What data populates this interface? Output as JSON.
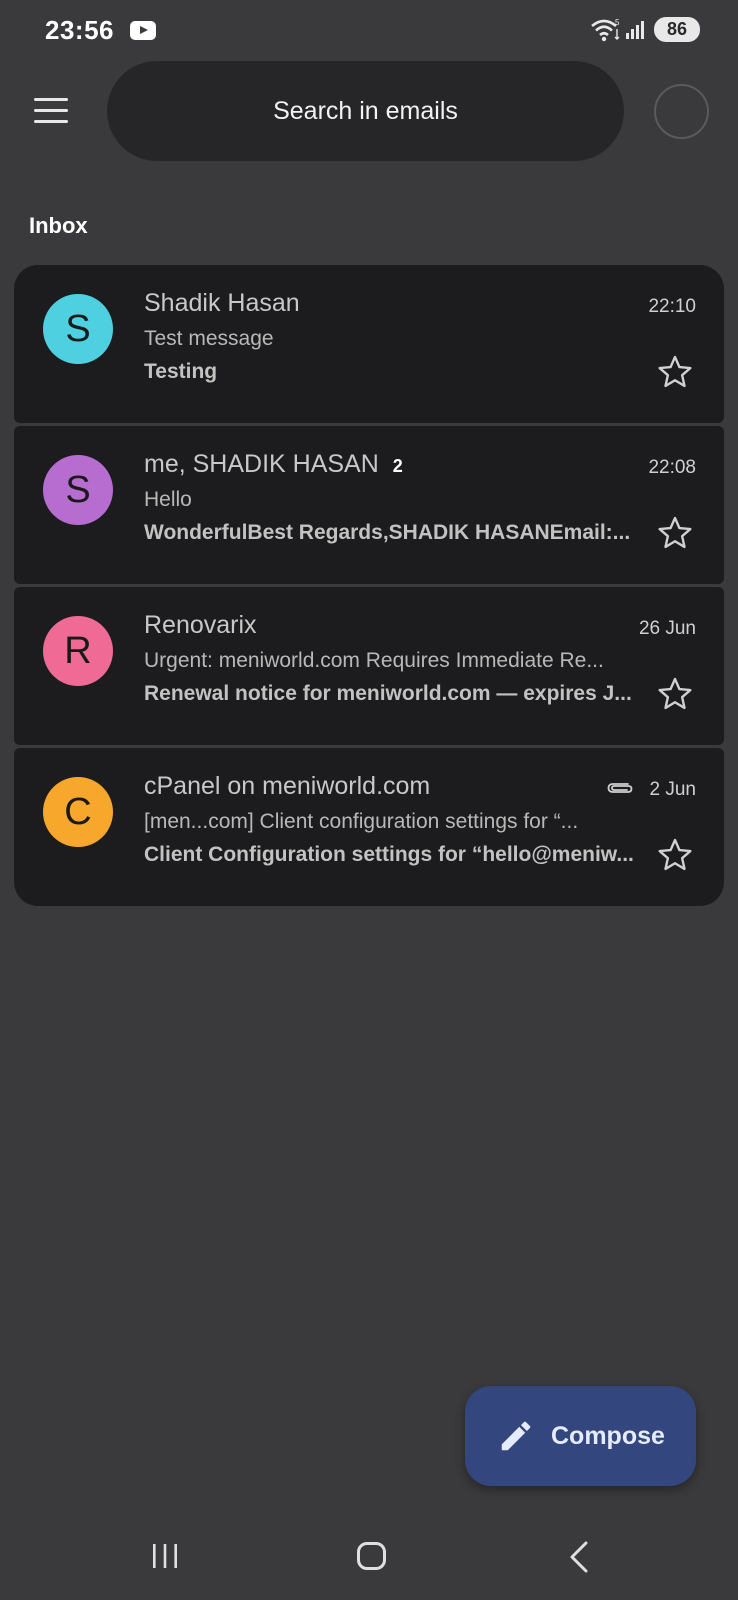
{
  "status_bar": {
    "time": "23:56",
    "battery": "86",
    "icons": [
      "youtube-icon",
      "wifi-icon",
      "signal-icon",
      "battery-icon"
    ]
  },
  "header": {
    "search_placeholder": "Search in emails"
  },
  "section_label": "Inbox",
  "emails": [
    {
      "avatar_letter": "S",
      "avatar_color": "#4fd0e0",
      "sender": "Shadik Hasan",
      "thread_count": "",
      "date": "22:10",
      "has_attachment": false,
      "subject": "Test message",
      "snippet": "Testing"
    },
    {
      "avatar_letter": "S",
      "avatar_color": "#b76cd0",
      "sender": "me, SHADIK HASAN",
      "thread_count": "2",
      "date": "22:08",
      "has_attachment": false,
      "subject": "Hello",
      "snippet": "WonderfulBest Regards,SHADIK HASANEmail:..."
    },
    {
      "avatar_letter": "R",
      "avatar_color": "#ef6a95",
      "sender": "Renovarix",
      "thread_count": "",
      "date": "26 Jun",
      "has_attachment": false,
      "subject": "Urgent: meniworld.com Requires Immediate Re...",
      "snippet": "Renewal notice for meniworld.com — expires J..."
    },
    {
      "avatar_letter": "C",
      "avatar_color": "#f6a72c",
      "sender": "cPanel on meniworld.com",
      "thread_count": "",
      "date": "2 Jun",
      "has_attachment": true,
      "subject": "[men...com] Client configuration settings for “...",
      "snippet": "Client Configuration settings for “hello@meniw..."
    }
  ],
  "compose": {
    "label": "Compose"
  },
  "nav": {
    "icons": [
      "recents-icon",
      "home-icon",
      "back-icon"
    ]
  }
}
